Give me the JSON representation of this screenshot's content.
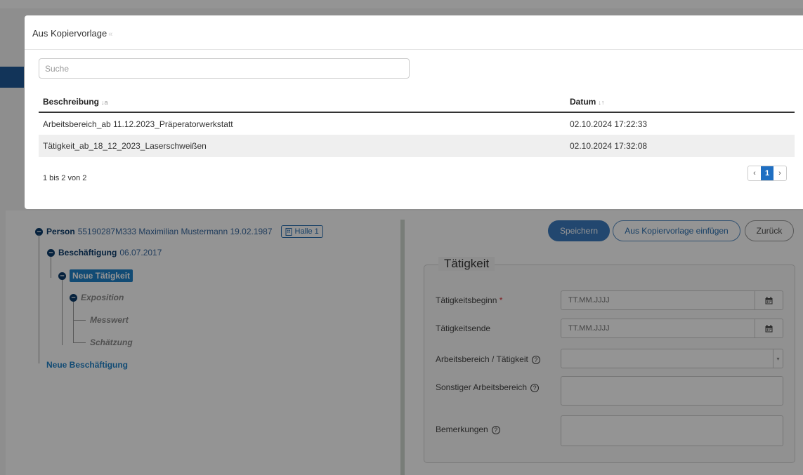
{
  "modal": {
    "title": "Aus Kopiervorlage",
    "close_glyph": "«",
    "search_placeholder": "Suche",
    "columns": {
      "beschreibung": "Beschreibung",
      "datum": "Datum"
    },
    "rows": [
      {
        "beschreibung": "Arbeitsbereich_ab 11.12.2023_Präperatorwerkstatt",
        "datum": "02.10.2024 17:22:33"
      },
      {
        "beschreibung": "Tätigkeit_ab_18_12_2023_Laserschweißen",
        "datum": "02.10.2024 17:32:08"
      }
    ],
    "info": "1 bis 2 von 2",
    "pager": {
      "prev": "‹",
      "current": "1",
      "next": "›"
    }
  },
  "tree": {
    "person_label": "Person",
    "person_value": "55190287M333 Maximilian Mustermann 19.02.1987",
    "halle": "Halle 1",
    "beschaeftigung_label": "Beschäftigung",
    "beschaeftigung_date": "06.07.2017",
    "neue_taetigkeit": "Neue Tätigkeit",
    "exposition": "Exposition",
    "messwert": "Messwert",
    "schaetzung": "Schätzung",
    "neue_beschaeftigung": "Neue Beschäftigung"
  },
  "actions": {
    "speichern": "Speichern",
    "kopiervorlage": "Aus Kopiervorlage einfügen",
    "zurueck": "Zurück"
  },
  "form": {
    "legend": "Tätigkeit",
    "taetigkeitsbeginn": "Tätigkeitsbeginn",
    "taetigkeitsende": "Tätigkeitsende",
    "arbeitsbereich": "Arbeitsbereich / Tätigkeit",
    "sonstiger": "Sonstiger Arbeitsbereich",
    "bemerkungen": "Bemerkungen",
    "date_placeholder": "TT.MM.JJJJ",
    "required_mark": "*"
  },
  "colors": {
    "primary": "#3b7bc0",
    "active_node": "#1f82c9",
    "navy": "#0b3c6b"
  }
}
